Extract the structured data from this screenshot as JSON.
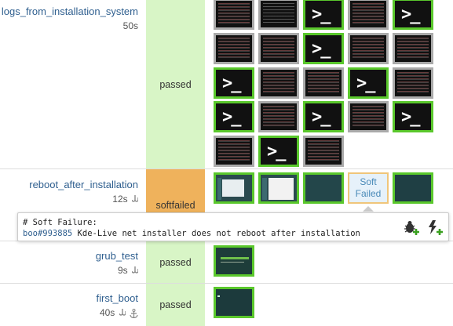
{
  "modules": [
    {
      "name": "logs_from_installation_system",
      "time": "50s",
      "result": "passed"
    },
    {
      "name": "reboot_after_installation",
      "time": "12s",
      "result": "softfailed"
    },
    {
      "name": "grub_test",
      "time": "9s",
      "result": "passed"
    },
    {
      "name": "first_boot",
      "time": "40s",
      "result": "passed"
    }
  ],
  "soft_failure_box": {
    "line1": "Soft",
    "line2": "Failed"
  },
  "tooltip": {
    "heading": "# Soft Failure:",
    "bug_ref": "boo#993885",
    "message": "Kde-Live net installer does not reboot after installation"
  },
  "icons": {
    "hook": "hook-icon",
    "anchor": "anchor-icon",
    "report_bug": "bug-plus-icon",
    "restart_flag": "flash-plus-icon"
  },
  "colors": {
    "passed": "#d8f5c6",
    "softfailed": "#efb25c",
    "thumb_ok": "#5ac82c",
    "link": "#2f5f8f"
  }
}
